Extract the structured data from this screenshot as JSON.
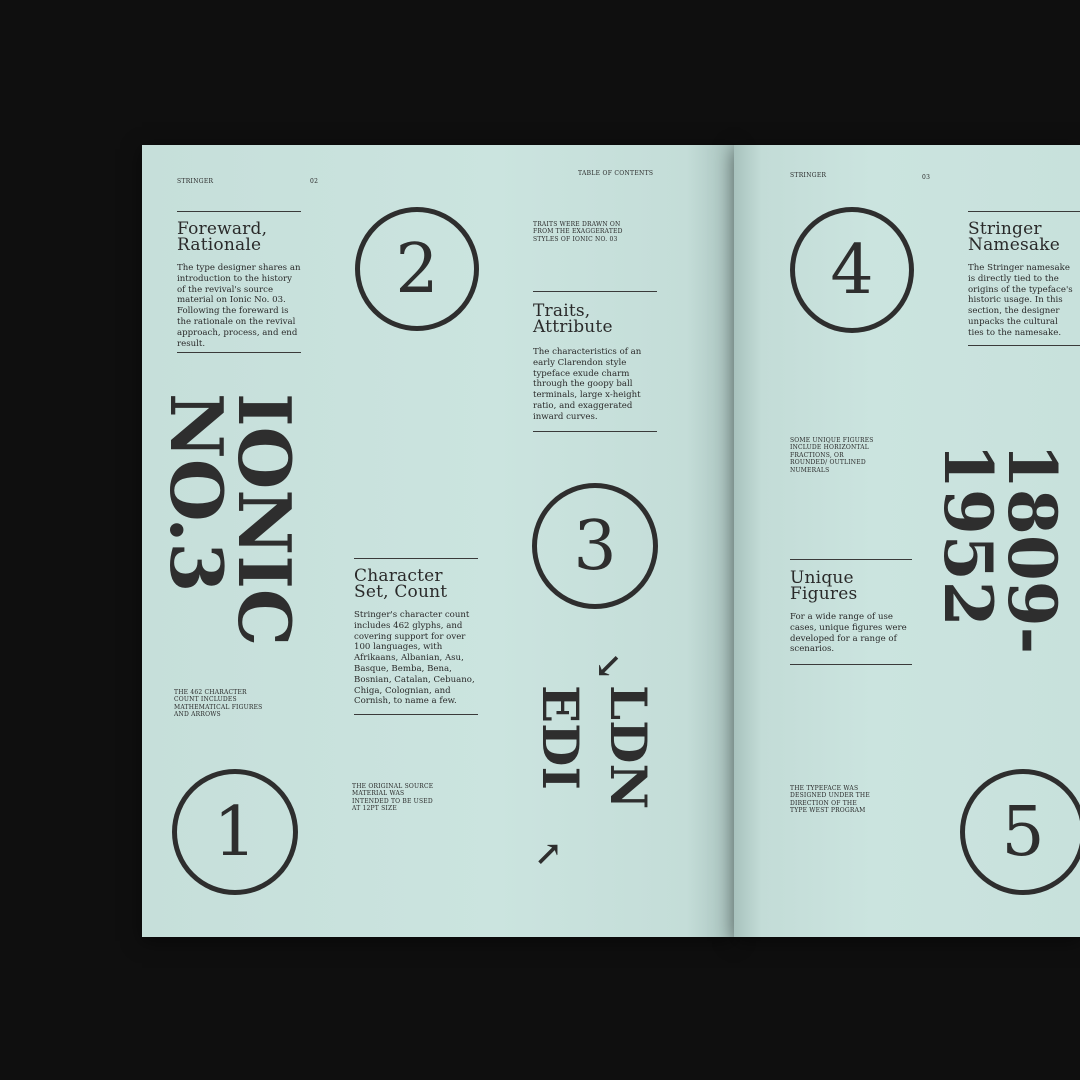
{
  "left_page": {
    "running_head": "STRINGER",
    "page_number": "02",
    "toc_label": "TABLE OF CONTENTS",
    "section_foreward": {
      "title_line1": "Foreward,",
      "title_line2": "Rationale",
      "body": "The type designer shares an introduction to the history of the revival's source material on Ionic No. 03. Following the foreward is the rationale on the revival approach, process, and end result."
    },
    "big_vertical_line1": "IONIC",
    "big_vertical_line2": "NO.3",
    "caption_462": "THE 462 CHARACTER COUNT INCLUDES MATHEMATICAL FIGURES AND ARROWS",
    "numeral_1": "1",
    "numeral_2": "2",
    "numeral_3": "3",
    "section_character": {
      "title_line1": "Character",
      "title_line2": "Set, Count",
      "body": "Stringer's character count includes 462 glyphs, and covering support for over 100 languages, with Afrikaans, Albanian, Asu, Basque, Bemba, Bena, Bosnian, Catalan, Cebuano, Chiga, Colognian, and Cornish, to name a few."
    },
    "caption_source": "THE ORIGINAL SOURCE MATERIAL WAS INTENDED TO BE USED AT 12PT SIZE",
    "caption_traits": "TRAITS WERE DRAWN ON FROM THE EXAGGERATED STYLES OF IONIC NO. 03",
    "section_traits": {
      "title_line1": "Traits,",
      "title_line2": "Attribute",
      "body": "The characteristics of an early Clarendon style typeface exude charm through the goopy ball terminals, large x-height ratio, and exaggerated inward curves."
    },
    "ldn_text": "LDN",
    "edi_text": "EDI",
    "arrow_top": "↙",
    "arrow_bottom": "↗"
  },
  "right_page": {
    "running_head": "STRINGER",
    "page_number": "03",
    "numeral_4": "4",
    "numeral_5": "5",
    "section_namesake": {
      "title_line1": "Stringer",
      "title_line2": "Namesake",
      "body": "The Stringer namesake is directly tied to the origins of the typeface's historic usage. In this section, the designer unpacks the cultural ties to the namesake."
    },
    "caption_figures": "SOME UNIQUE FIGURES INCLUDE HORIZONTAL FRACTIONS, OR ROUNDED/ OUTLINED NUMERALS",
    "years_line1": "1809-",
    "years_line2": "1952",
    "section_figures": {
      "title_line1": "Unique",
      "title_line2": "Figures",
      "body": "For a wide range of use cases, unique figures were developed for a range of scenarios."
    },
    "caption_program": "THE TYPEFACE WAS DESIGNED UNDER THE DIRECTION OF THE TYPE WEST PROGRAM"
  },
  "colors": {
    "background": "#0f0f0f",
    "paper": "#c9e2dd",
    "ink": "#2e2e2e"
  }
}
